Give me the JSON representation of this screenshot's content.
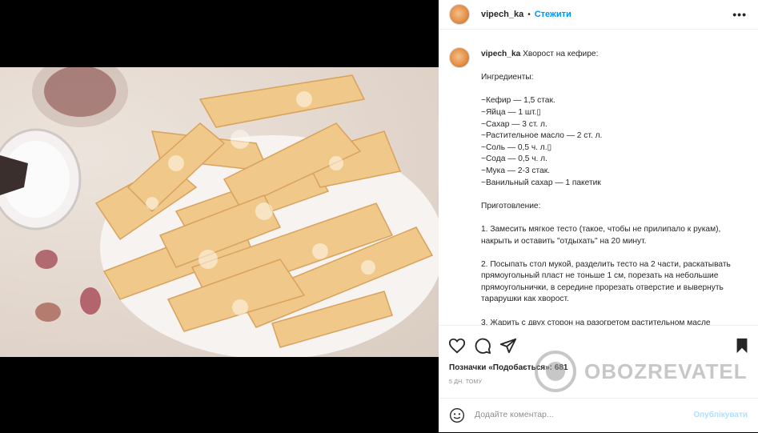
{
  "post": {
    "username": "vipech_ka",
    "separator": "•",
    "follow_label": "Стежити",
    "more_label": "•••",
    "caption_title": "Хворост на кефире:",
    "caption_lines": [
      "",
      "Ингредиенты:",
      "",
      "~Кефир — 1,5 стак.",
      "~Яйца — 1 шт.▯",
      "~Сахар — 3 ст. л.",
      "~Растительное масло — 2 ст. л.",
      "~Соль — 0,5 ч. л.▯",
      "~Сода — 0,5 ч. л.",
      "~Мука — 2-3 стак.",
      "~Ванильный сахар — 1 пакетик",
      "",
      "Приготовление:",
      "",
      "1. Замесить мягкое тесто (такое, чтобы не прилипало к рукам), накрыть и оставить \"отдыхать\" на 20 минут.",
      "",
      "2. Посыпать стол мукой, разделить тесто на 2 части, раскатывать прямоугольный пласт не тоньше 1 см, порезать на небольшие прямоугольнички, в середине прорезать отверстие и вывернуть тарарушки как хворост.",
      "",
      "3. Жарить с двух сторон на разогретом растительном масле"
    ],
    "likes_label": "Позначки «Подобається»:",
    "likes_count": "681",
    "time_label": "5 ДН. ТОМУ",
    "comment_placeholder": "Додайте коментар...",
    "publish_label": "Опублікувати"
  },
  "watermark": {
    "text": "OBOZREVATEL"
  },
  "icons": {
    "like": "heart-icon",
    "comment": "comment-icon",
    "share": "share-icon",
    "save": "bookmark-icon",
    "emoji": "emoji-icon"
  },
  "colors": {
    "accent": "#0095f6",
    "publish_disabled": "#b2dffc",
    "muted": "#8e8e8e",
    "border": "#efefef"
  }
}
